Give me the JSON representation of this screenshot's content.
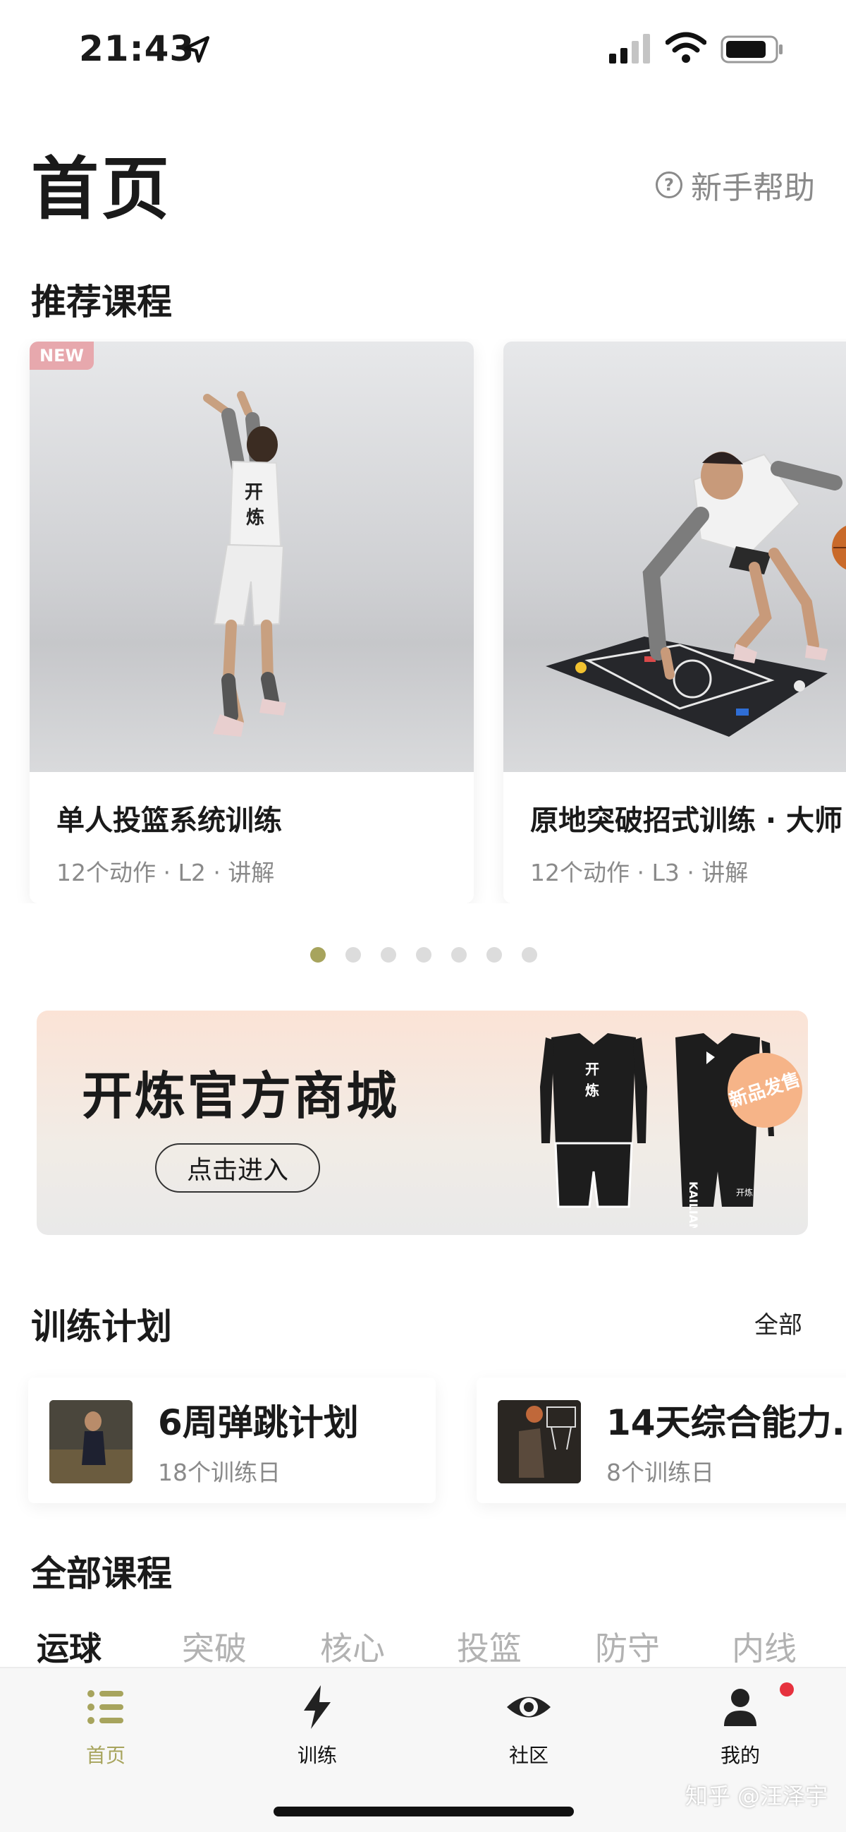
{
  "status_bar": {
    "time": "21:43"
  },
  "header": {
    "title": "首页",
    "help_label": "新手帮助",
    "help_icon": "question-circle-icon"
  },
  "recommended": {
    "title": "推荐课程",
    "courses": [
      {
        "badge": "NEW",
        "title": "单人投篮系统训练",
        "meta": "12个动作 · L2 · 讲解"
      },
      {
        "badge": "",
        "title": "原地突破招式训练 · 大师",
        "meta": "12个动作 · L3 · 讲解"
      }
    ],
    "pages": 7,
    "active_page": 1
  },
  "mall": {
    "title": "开炼官方商城",
    "button": "点击进入",
    "badge": "新品发售",
    "jersey_text_1": "开\n炼",
    "jersey_text_2": "KAILIAN",
    "jersey_text_3": "开炼"
  },
  "training_plans": {
    "title": "训练计划",
    "all_label": "全部",
    "plans": [
      {
        "title": "6周弹跳计划",
        "meta": "18个训练日"
      },
      {
        "title": "14天综合能力...",
        "meta": "8个训练日"
      }
    ]
  },
  "all_courses": {
    "title": "全部课程",
    "tabs": [
      "运球",
      "突破",
      "核心",
      "投篮",
      "防守",
      "内线"
    ],
    "active_tab": 0
  },
  "bottom_nav": {
    "items": [
      {
        "label": "首页",
        "icon": "list-icon"
      },
      {
        "label": "训练",
        "icon": "lightning-icon"
      },
      {
        "label": "社区",
        "icon": "eye-icon"
      },
      {
        "label": "我的",
        "icon": "person-icon"
      }
    ],
    "active": 0
  },
  "watermark": "知乎 @汪泽宇",
  "colors": {
    "accent": "#a7a45d",
    "badge_new": "#e7a8ad",
    "notification": "#e6323e",
    "mall_badge": "#f6b488"
  }
}
